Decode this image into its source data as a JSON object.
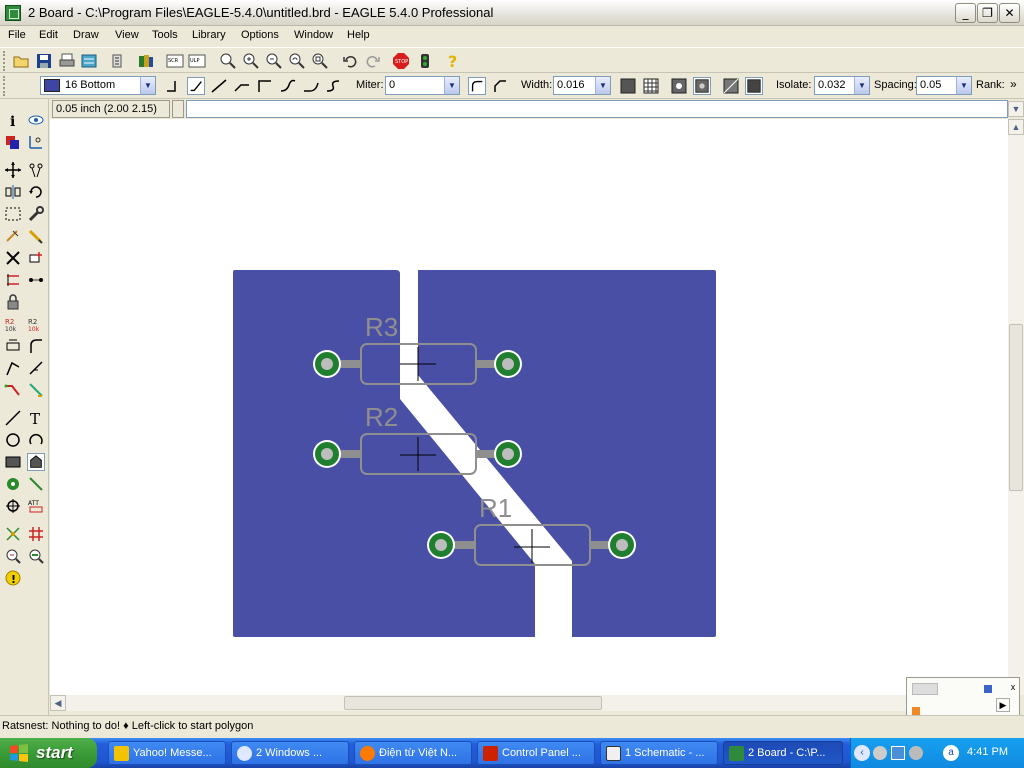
{
  "window": {
    "title": "2 Board - C:\\Program Files\\EAGLE-5.4.0\\untitled.brd - EAGLE 5.4.0 Professional",
    "minimize_label": "_",
    "maximize_label": "❐",
    "close_label": "✕"
  },
  "menu": {
    "items": [
      "File",
      "Edit",
      "Draw",
      "View",
      "Tools",
      "Library",
      "Options",
      "Window",
      "Help"
    ]
  },
  "toolbar": {
    "layer_select": "16 Bottom",
    "miter_label": "Miter:",
    "miter_value": "0",
    "width_label": "Width:",
    "width_value": "0.016",
    "isolate_label": "Isolate:",
    "isolate_value": "0.032",
    "spacing_label": "Spacing:",
    "spacing_value": "0.05",
    "rank_label": "Rank:",
    "more_label": "»"
  },
  "command": {
    "coordinates": "0.05 inch (2.00 2.15)",
    "input_value": ""
  },
  "board": {
    "polygon_color": "#4a4fa6",
    "pad_color": "#1f7f2f",
    "outline_color": "#8f8f8f",
    "components": [
      {
        "name": "R3"
      },
      {
        "name": "R2"
      },
      {
        "name": "R1"
      }
    ]
  },
  "status": {
    "text": "Ratsnest: Nothing to do!  ♦ Left-click to start polygon"
  },
  "taskbar": {
    "start_label": "start",
    "tasks": [
      {
        "label": "Yahoo! Messe...",
        "icon_color": "#f2c300"
      },
      {
        "label": "2 Windows ...",
        "icon_color": "#dfe8ff"
      },
      {
        "label": "Điện từ Việt N...",
        "icon_color": "#ff7a00"
      },
      {
        "label": "Control Panel ...",
        "icon_color": "#cc2200"
      },
      {
        "label": "1 Schematic - ...",
        "icon_color": "#f0f0f0"
      },
      {
        "label": "2 Board - C:\\P...",
        "icon_color": "#2f8a3c"
      }
    ],
    "clock": "4:41 PM"
  }
}
